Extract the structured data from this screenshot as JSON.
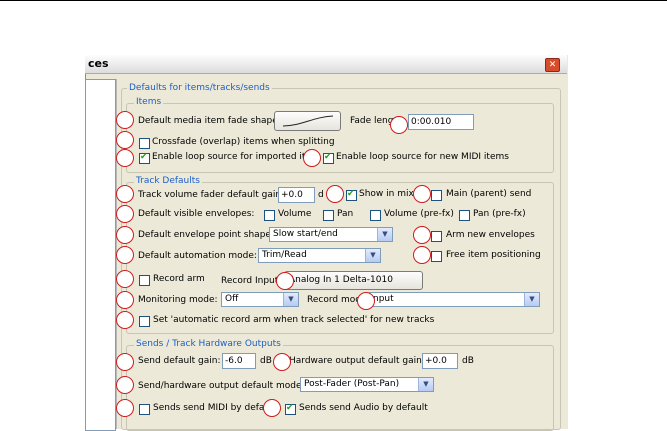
{
  "window": {
    "title": "ces"
  },
  "sections": {
    "outer": "Defaults for items/tracks/sends",
    "items": "Items",
    "track": "Track Defaults",
    "sends": "Sends / Track Hardware Outputs"
  },
  "items": {
    "fade_shape_label": "Default media item fade shape:",
    "fade_length_label": "Fade leng",
    "fade_length_value": "0:00.010",
    "crossfade_label": "Crossfade (overlap) items when splitting",
    "loop_imported_label": "Enable loop source for imported iten",
    "loop_midi_label": "Enable loop source for new MIDI items"
  },
  "track": {
    "volume_gain_label": "Track volume fader default gain:",
    "volume_gain_value": "+0.0",
    "volume_unit": "d",
    "show_in_mixer_label": "Show in mixe",
    "main_send_label": "Main (parent) send",
    "visible_env_label": "Default visible envelopes:",
    "env_volume": "Volume",
    "env_pan": "Pan",
    "env_volume_prefx": "Volume (pre-fx)",
    "env_pan_prefx": "Pan (pre-fx)",
    "env_point_label": "Default envelope point shape:",
    "env_point_value": "Slow start/end",
    "arm_env_label": "Arm new envelopes",
    "automation_label": "Default automation mode:",
    "automation_value": "Trim/Read",
    "free_item_label": "Free item positioning",
    "record_arm_label": "Record arm",
    "record_input_label": "Record Input",
    "record_input_value": "Analog In 1 Delta-1010",
    "monitoring_label": "Monitoring mode:",
    "monitoring_value": "Off",
    "record_mode_label": "Record mod",
    "record_mode_value": "nput",
    "auto_arm_label": "Set 'automatic record arm when track selected' for new tracks"
  },
  "sends": {
    "send_gain_label": "Send default gain:",
    "send_gain_value": "-6.0",
    "send_gain_unit": "dB",
    "hw_gain_label": "Hardware output default gain:",
    "hw_gain_value": "+0.0",
    "hw_gain_unit": "dB",
    "send_mode_label": "Send/hardware output default mode:",
    "send_mode_value": "Post-Fader (Post-Pan)",
    "midi_label": "Sends send MIDI by defa",
    "audio_label": "Sends send Audio by default"
  },
  "checkbox_states": {
    "crossfade": false,
    "loop_imported": true,
    "loop_midi": true,
    "show_in_mixer": true,
    "main_send": false,
    "env_volume": false,
    "env_pan": false,
    "env_volume_prefx": false,
    "env_pan_prefx": false,
    "arm_env": false,
    "free_item": false,
    "record_arm": false,
    "auto_arm": false,
    "midi": false,
    "audio": true
  },
  "icons": {
    "close": "close-icon",
    "dropdown": "chevron-down-icon"
  },
  "colors": {
    "accent_legend": "#1c5fc8",
    "marker": "#d01b1b",
    "check": "#21a121"
  }
}
